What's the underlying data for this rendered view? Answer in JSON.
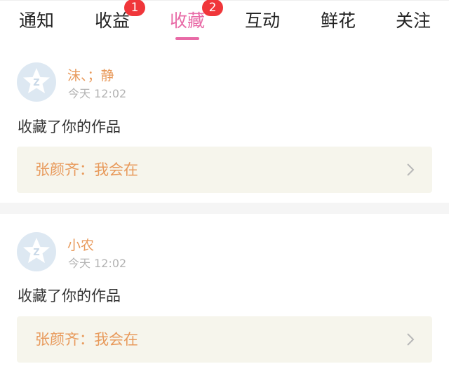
{
  "tabs": [
    {
      "label": "通知",
      "badge": null,
      "active": false
    },
    {
      "label": "收益",
      "badge": "1",
      "active": false
    },
    {
      "label": "收藏",
      "badge": "2",
      "active": true
    },
    {
      "label": "互动",
      "badge": null,
      "active": false
    },
    {
      "label": "鲜花",
      "badge": null,
      "active": false
    },
    {
      "label": "关注",
      "badge": null,
      "active": false
    }
  ],
  "items": [
    {
      "user": "沫、；静",
      "time": "今天 12:02",
      "action": "收藏了你的作品",
      "work": "张颜齐：我会在"
    },
    {
      "user": "小农",
      "time": "今天 12:02",
      "action": "收藏了你的作品",
      "work": "张颜齐：我会在"
    }
  ],
  "colors": {
    "accent": "#e86aa6",
    "badge": "#f0363a",
    "username": "#e89a5c",
    "work_box_bg": "#f6f5ec",
    "avatar_bg": "#dde8f2"
  },
  "icons": {
    "avatar": "default-avatar-star-icon",
    "work_arrow": "chevron-right-icon"
  }
}
